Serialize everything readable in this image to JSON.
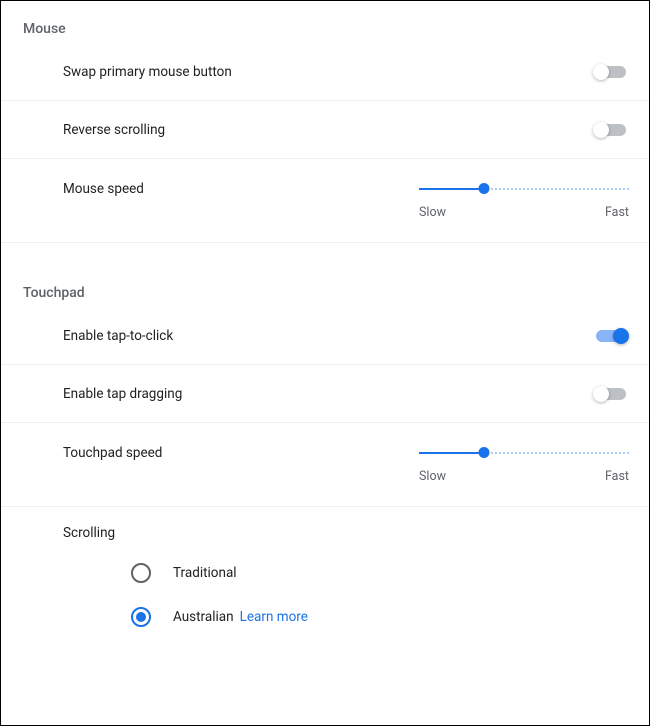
{
  "mouse": {
    "heading": "Mouse",
    "swap_label": "Swap primary mouse button",
    "swap_on": false,
    "reverse_label": "Reverse scrolling",
    "reverse_on": false,
    "speed_label": "Mouse speed",
    "speed_percent": 31,
    "slow": "Slow",
    "fast": "Fast"
  },
  "touchpad": {
    "heading": "Touchpad",
    "tap_label": "Enable tap-to-click",
    "tap_on": true,
    "drag_label": "Enable tap dragging",
    "drag_on": false,
    "speed_label": "Touchpad speed",
    "speed_percent": 31,
    "slow": "Slow",
    "fast": "Fast",
    "scrolling_label": "Scrolling",
    "traditional_label": "Traditional",
    "australian_label": "Australian",
    "learn_more": "Learn more",
    "scroll_selected": "australian"
  }
}
